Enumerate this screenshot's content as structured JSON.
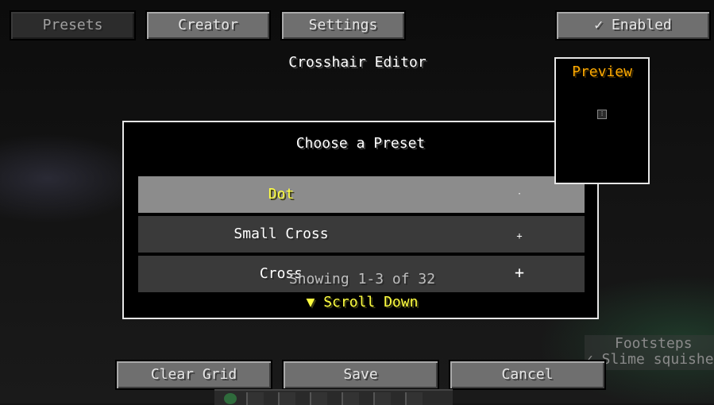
{
  "top_tabs": {
    "presets": "Presets",
    "creator": "Creator",
    "settings": "Settings"
  },
  "toggle": {
    "label": "✓ Enabled"
  },
  "title": "Crosshair Editor",
  "preview": {
    "title": "Preview"
  },
  "modal": {
    "title": "Choose a Preset",
    "presets": [
      {
        "name": "Dot",
        "glyph": "·",
        "selected": true
      },
      {
        "name": "Small Cross",
        "glyph": "+",
        "selected": false
      },
      {
        "name": "Cross",
        "glyph": "+",
        "selected": false
      }
    ],
    "showing": "Showing 1-3 of 32",
    "scroll_down": "▼ Scroll Down"
  },
  "bottom_buttons": {
    "clear": "Clear Grid",
    "save": "Save",
    "cancel": "Cancel"
  },
  "toast": {
    "line1": "Footsteps",
    "line2": "✓ Slime squishes"
  },
  "colors": {
    "accent_yellow": "#ffff40",
    "preview_orange": "#ffaa00",
    "button_gray": "#6f6f6f",
    "selected_row": "#8c8c8c"
  }
}
